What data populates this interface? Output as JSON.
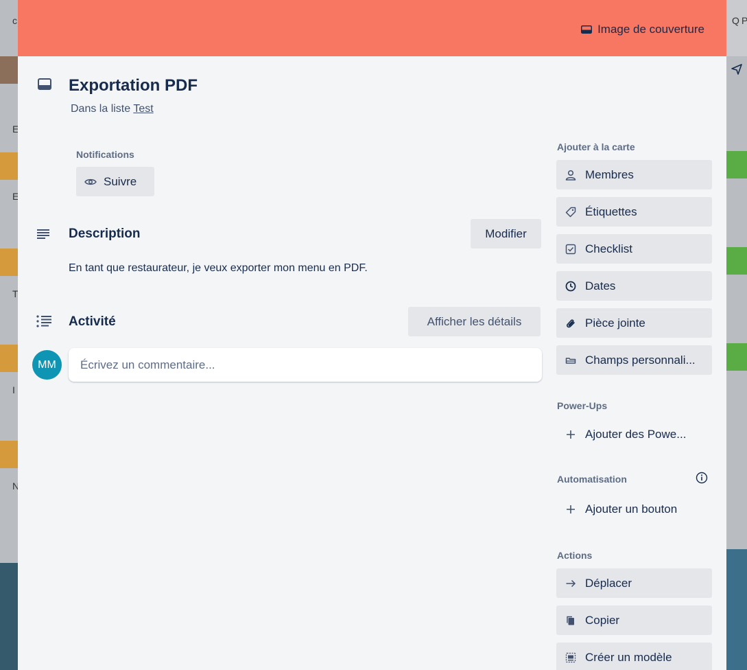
{
  "background": {
    "left_letters": [
      "c",
      "E",
      "E",
      "T",
      "I",
      "N"
    ],
    "right_letters": [
      "Q",
      "P"
    ]
  },
  "cover": {
    "button_label": "Image de couverture",
    "color": "#f87762"
  },
  "card": {
    "title": "Exportation PDF",
    "list_prefix": "Dans la liste",
    "list_name": "Test"
  },
  "notifications": {
    "label": "Notifications",
    "button": "Suivre"
  },
  "description": {
    "title": "Description",
    "edit_button": "Modifier",
    "text": "En tant que restaurateur, je veux exporter mon menu en PDF."
  },
  "activity": {
    "title": "Activité",
    "details_button": "Afficher les détails",
    "avatar_initials": "MM",
    "avatar_color": "#0d95b3",
    "comment_placeholder": "Écrivez un commentaire..."
  },
  "sidebar": {
    "add_heading": "Ajouter à la carte",
    "add_items": [
      {
        "label": "Membres",
        "icon": "person-icon"
      },
      {
        "label": "Étiquettes",
        "icon": "tag-icon"
      },
      {
        "label": "Checklist",
        "icon": "checkbox-icon"
      },
      {
        "label": "Dates",
        "icon": "clock-icon"
      },
      {
        "label": "Pièce jointe",
        "icon": "paperclip-icon"
      },
      {
        "label": "Champs personnali...",
        "icon": "fields-icon"
      }
    ],
    "powerups_heading": "Power-Ups",
    "powerups_button": "Ajouter des Powe...",
    "automation_heading": "Automatisation",
    "automation_button": "Ajouter un bouton",
    "actions_heading": "Actions",
    "actions": [
      {
        "label": "Déplacer",
        "icon": "arrow-right-icon"
      },
      {
        "label": "Copier",
        "icon": "copy-icon"
      },
      {
        "label": "Créer un modèle",
        "icon": "template-icon"
      }
    ]
  }
}
